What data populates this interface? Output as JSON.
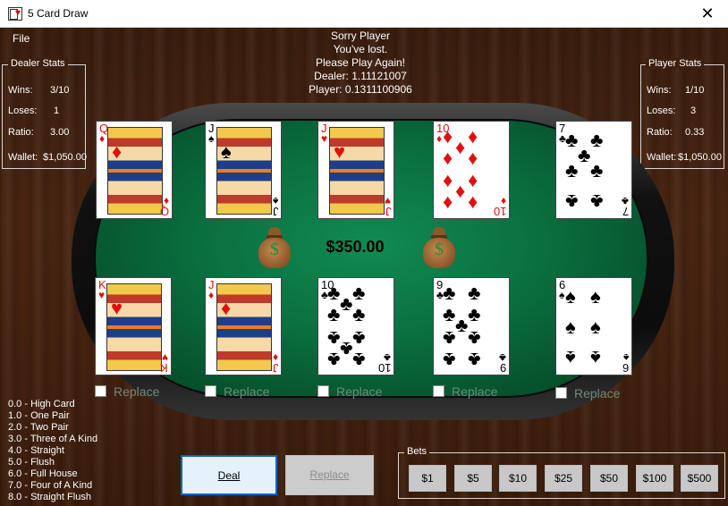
{
  "window": {
    "title": "5 Card Draw",
    "close_glyph": "✕"
  },
  "menu": {
    "file": "File"
  },
  "message": {
    "line1": "Sorry Player",
    "line2": "You've lost.",
    "line3": "Please Play Again!",
    "line4": "Dealer: 1.11121007",
    "line5": "Player: 0.1311100906"
  },
  "dealer_stats": {
    "title": "Dealer Stats",
    "wins_label": "Wins:",
    "wins": "3/10",
    "loses_label": "Loses:",
    "loses": "1",
    "ratio_label": "Ratio:",
    "ratio": "3.00",
    "wallet_label": "Wallet:",
    "wallet": "$1,050.00"
  },
  "player_stats": {
    "title": "Player Stats",
    "wins_label": "Wins:",
    "wins": "1/10",
    "loses_label": "Loses:",
    "loses": "3",
    "ratio_label": "Ratio:",
    "ratio": "0.33",
    "wallet_label": "Wallet:",
    "wallet": "$1,050.00"
  },
  "dealer_hand": [
    {
      "rank": "Q",
      "suit": "♦",
      "color": "red"
    },
    {
      "rank": "J",
      "suit": "♠",
      "color": "black"
    },
    {
      "rank": "J",
      "suit": "♥",
      "color": "red"
    },
    {
      "rank": "10",
      "suit": "♦",
      "color": "red"
    },
    {
      "rank": "7",
      "suit": "♣",
      "color": "black"
    }
  ],
  "player_hand": [
    {
      "rank": "K",
      "suit": "♥",
      "color": "red"
    },
    {
      "rank": "J",
      "suit": "♦",
      "color": "red"
    },
    {
      "rank": "10",
      "suit": "♣",
      "color": "black"
    },
    {
      "rank": "9",
      "suit": "♣",
      "color": "black"
    },
    {
      "rank": "6",
      "suit": "♠",
      "color": "black"
    }
  ],
  "pot": "$350.00",
  "bag_symbol": "$",
  "replace_label": "Replace",
  "hand_rankings": [
    "0.0 - High Card",
    "1.0 - One Pair",
    "2.0 - Two Pair",
    "3.0 - Three of A Kind",
    "4.0 - Straight",
    "5.0 - Flush",
    "6.0 - Full House",
    "7.0 - Four of A Kind",
    "8.0 - Straight Flush"
  ],
  "buttons": {
    "deal": "Deal",
    "replace": "Replace"
  },
  "bets": {
    "title": "Bets",
    "amounts": [
      "$1",
      "$5",
      "$10",
      "$25",
      "$50",
      "$100",
      "$500"
    ]
  },
  "colors": {
    "felt": "#0a6e3f",
    "wood": "#4a2613",
    "red_suit": "#e01010",
    "deal_focus": "#0a64c8"
  }
}
